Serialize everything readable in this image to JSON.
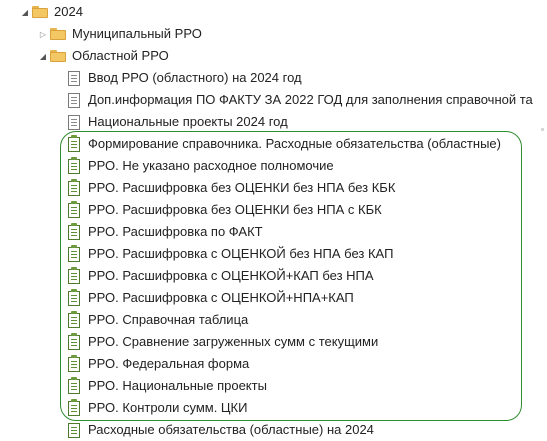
{
  "tree": {
    "root": {
      "label": "2024",
      "children": [
        {
          "label": "Муниципальный РРО",
          "state": "collapsed"
        },
        {
          "label": "Областной РРО",
          "state": "expanded",
          "items": [
            {
              "label": "Ввод РРО (областного) на 2024 год",
              "icon": "document-icon"
            },
            {
              "label": "Доп.информация ПО ФАКТУ ЗА 2022 ГОД для заполнения справочной та",
              "icon": "document-icon"
            },
            {
              "label": "Национальные проекты 2024 год",
              "icon": "document-icon"
            },
            {
              "label": "Формирование справочника. Расходные обязательства (областные)",
              "icon": "report-icon"
            },
            {
              "label": "РРО. Не указано расходное полномочие",
              "icon": "report-icon"
            },
            {
              "label": "РРО. Расшифровка без ОЦЕНКИ без НПА без КБК",
              "icon": "report-icon"
            },
            {
              "label": "РРО. Расшифровка без ОЦЕНКИ без НПА с КБК",
              "icon": "report-icon"
            },
            {
              "label": "РРО. Расшифровка по ФАКТ",
              "icon": "report-icon"
            },
            {
              "label": "РРО. Расшифровка с ОЦЕНКОЙ без НПА без КАП",
              "icon": "report-icon"
            },
            {
              "label": "РРО. Расшифровка с ОЦЕНКОЙ+КАП без НПА",
              "icon": "report-icon"
            },
            {
              "label": "РРО. Расшифровка с ОЦЕНКОЙ+НПА+КАП",
              "icon": "report-icon"
            },
            {
              "label": "РРО. Справочная таблица",
              "icon": "report-icon"
            },
            {
              "label": "РРО. Сравнение загруженных сумм с текущими",
              "icon": "report-icon"
            },
            {
              "label": "РРО. Федеральная форма",
              "icon": "report-icon"
            },
            {
              "label": "РРО. Национальные проекты",
              "icon": "report-icon"
            },
            {
              "label": "РРО. Контроли сумм. ЦКИ",
              "icon": "report-icon"
            },
            {
              "label": "Расходные обязательства (областные) на 2024",
              "icon": "form-icon"
            }
          ]
        }
      ]
    }
  },
  "colors": {
    "highlight_frame": "#2e8b2e",
    "folder": "#f4c765",
    "report_icon": "#5f8f34"
  }
}
